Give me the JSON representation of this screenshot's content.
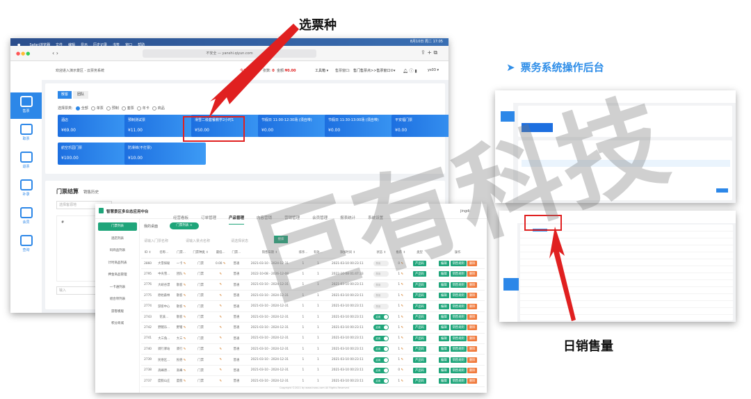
{
  "annotations": {
    "select_ticket": "选票种",
    "backend_title": "票务系统操作后台",
    "backend_arrow": "➤",
    "daily_sales": "日销售量"
  },
  "watermark": "巨有科技",
  "colors": {
    "blue": "#2c87e8",
    "green": "#1fa57a",
    "red": "#e02020",
    "orange": "#f07a3c"
  },
  "pos": {
    "menubar": [
      "Safari浏览器",
      "文件",
      "编辑",
      "显示",
      "历史记录",
      "书签",
      "窗口",
      "帮助"
    ],
    "clock": "8月10日 周二 17:05",
    "url": "不安全 — yanshi.qiyun.com",
    "welcome": "欢迎进入演示景区 - 云票务系统",
    "today": "今日统计",
    "count_label": "张数:",
    "count": "0",
    "amount_label": "金额:",
    "amount": "¥0.00",
    "toolbox": "工具箱 ▾",
    "window_label": "售票窗口:",
    "window_value": "售门售票点>>售票窗口②▾",
    "user": "ys03 ▾",
    "sidebar": [
      "售票",
      "取票",
      "退票",
      "补录",
      "会员",
      "查询"
    ],
    "tabs": [
      "散客",
      "团队"
    ],
    "filter_label": "选择票类:",
    "filters": [
      "全部",
      "单票",
      "预制",
      "套票",
      "年卡",
      "商品"
    ],
    "tickets": [
      {
        "name": "酒店",
        "price": "¥69.00"
      },
      {
        "name": "预制测试票",
        "price": "¥11.00"
      },
      {
        "name": "滑雪二级套餐教学2小时1",
        "price": "¥50.00"
      },
      {
        "name": "节假日 11:00-12:30场 (须自带)",
        "price": "¥0.00"
      },
      {
        "name": "节假日 11:30-13:00场 (须自带)",
        "price": "¥0.00"
      },
      {
        "name": "平安福门票",
        "price": "¥0.00"
      },
      {
        "name": "航空乐园门票",
        "price": "¥100.00"
      },
      {
        "name": "防滑袜(不打票)",
        "price": "¥10.00"
      }
    ],
    "settle_title": "门票结算",
    "settle_tab": "销售历史",
    "select_placeholder": "选择客源地",
    "hash": "#",
    "input_placeholder": "输入"
  },
  "admin": {
    "brand": "智慧景区多业态应用中台",
    "nav": [
      "经营看板",
      "订单管理",
      "产品管理",
      "内容营销",
      "营销管理",
      "会员管理",
      "报表统计",
      "系统设置"
    ],
    "nav_active": 2,
    "user": "jingdi",
    "side": [
      "门票列表",
      "酒店列表",
      "码商品列表",
      "计时商品列表",
      "押金商品管理",
      "一卡通列表",
      "组合项列表",
      "游客模版",
      "积分商城"
    ],
    "breadcrumb": "我的桌面",
    "active_tab": "门票列表 ×",
    "search": [
      "请输入门票名称",
      "请输入景点名称",
      "请选择状态"
    ],
    "search_btn": "搜索",
    "columns": [
      "ID ↕",
      "名称...",
      "门票...",
      "门票种类 ↕",
      "最低...",
      "门票...",
      "销售日期 ↕",
      "排序...",
      "有效...",
      "添加时间 ↕",
      "状态 ↕",
      "推荐 ↕",
      "类型",
      "操作"
    ],
    "rows": [
      [
        "2860",
        "大雪探秘",
        "一卡",
        "门票",
        "0.00",
        "普通",
        "2021-03-10 - 2024-12-31",
        "1",
        "1",
        "2021-03-10 00:23:11",
        "off",
        "0",
        "产品码"
      ],
      [
        "2795",
        "中央雪...",
        "团队",
        "门票",
        "",
        "普通",
        "2022-10-08 - 2026-12-08",
        "1",
        "1",
        "2022-10-08 01:47:33",
        "off",
        "1",
        "产品码"
      ],
      [
        "2776",
        "大峡谷漂",
        "散客",
        "门票",
        "",
        "普通",
        "2021-03-10 - 2024-12-31",
        "1",
        "1",
        "2021-03-10 00:23:11",
        "off",
        "1",
        "产品码"
      ],
      [
        "2775",
        "原始森林",
        "散客",
        "门票",
        "",
        "普通",
        "2021-03-10 - 2024-12-31",
        "1",
        "1",
        "2021-03-10 00:23:11",
        "off",
        "1",
        "产品码"
      ],
      [
        "2774",
        "游客中心",
        "散客",
        "门票",
        "",
        "普通",
        "2021-03-10 - 2024-12-31",
        "1",
        "1",
        "2021-03-10 00:23:11",
        "off",
        "1",
        "产品码"
      ],
      [
        "2743",
        "花溪...",
        "散客",
        "门票",
        "",
        "普通",
        "2021-03-10 - 2024-12-31",
        "1",
        "1",
        "2021-03-10 00:23:11",
        "on",
        "1",
        "产品码"
      ],
      [
        "2742",
        "野猪乐...",
        "野猪",
        "门票",
        "",
        "普通",
        "2021-03-10 - 2024-12-31",
        "1",
        "1",
        "2021-03-10 00:23:11",
        "on",
        "1",
        "产品码"
      ],
      [
        "2741",
        "大三角...",
        "大三",
        "门票",
        "",
        "普通",
        "2021-03-10 - 2024-12-31",
        "1",
        "1",
        "2021-03-10 00:23:11",
        "on",
        "1",
        "产品码"
      ],
      [
        "2740",
        "骑行驿站",
        "骑行",
        "门票",
        "",
        "普通",
        "2021-03-10 - 2024-12-31",
        "1",
        "1",
        "2021-03-10 00:23:11",
        "on",
        "1",
        "产品码"
      ],
      [
        "2739",
        "民俗区...",
        "民俗",
        "门票",
        "",
        "普通",
        "2021-03-10 - 2024-12-31",
        "1",
        "1",
        "2021-03-10 00:23:11",
        "on",
        "1",
        "产品码"
      ],
      [
        "2738",
        "高峰原...",
        "高峰",
        "门票",
        "",
        "普通",
        "2021-03-10 - 2024-12-31",
        "1",
        "1",
        "2021-03-10 00:23:11",
        "on",
        "0",
        "产品码"
      ],
      [
        "2737",
        "度假山庄",
        "度假",
        "门票",
        "",
        "普通",
        "2021-03-10 - 2024-12-31",
        "1",
        "1",
        "2021-03-10 00:23:11",
        "on",
        "1",
        "产品码"
      ]
    ],
    "toggle_on": "启用",
    "toggle_off": "禁用",
    "actions": [
      "编辑",
      "销售规则",
      "删除"
    ],
    "footer": "Copyright ©2021 by www.iruwu.com All Rights Reserved"
  }
}
